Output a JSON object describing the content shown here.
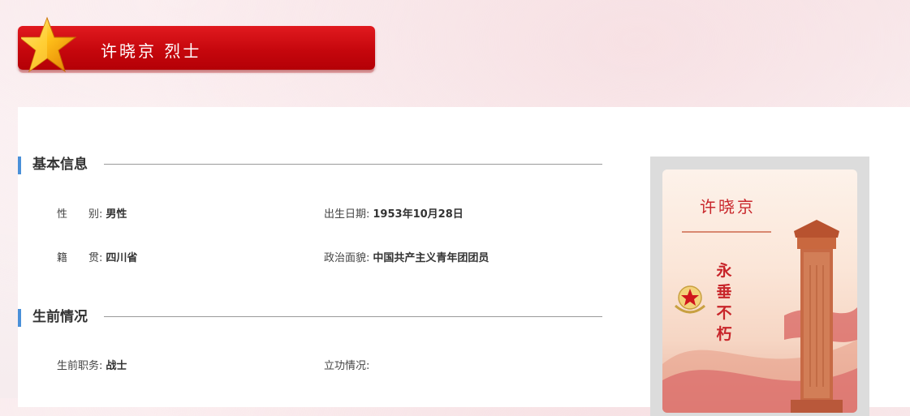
{
  "header": {
    "title": "许晓京 烈士"
  },
  "basic_info": {
    "section_title": "基本信息",
    "gender_label": "性　　别:",
    "gender_value": "男性",
    "birth_label": "出生日期:",
    "birth_value": "1953年10月28日",
    "origin_label": "籍　　贯:",
    "origin_value": "四川省",
    "political_label": "政治面貌:",
    "political_value": "中国共产主义青年团团员"
  },
  "life_info": {
    "section_title": "生前情况",
    "post_label": "生前职务:",
    "post_value": "战士",
    "merit_label": "立功情况:",
    "merit_value": ""
  },
  "poster": {
    "name": "许晓京",
    "slogan": "永垂不朽"
  },
  "colors": {
    "ribbon_red": "#d10a10",
    "accent_blue": "#4a90d9",
    "poster_red": "#c9272c"
  }
}
